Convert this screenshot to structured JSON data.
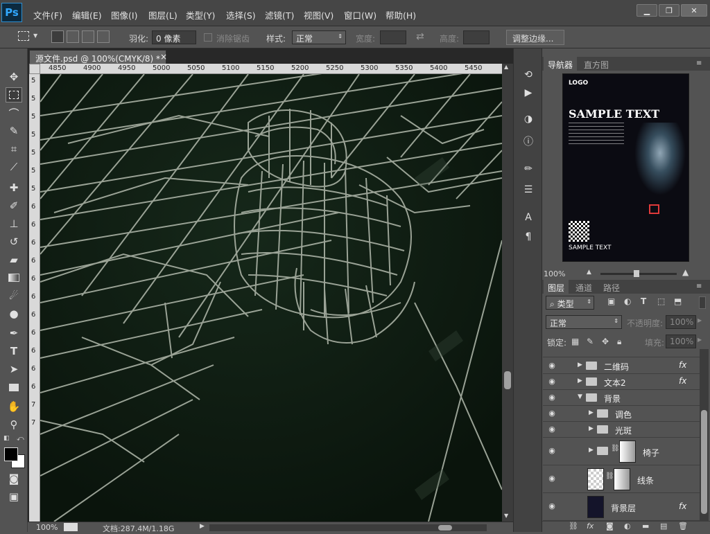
{
  "app": {
    "logo": "Ps"
  },
  "menu": [
    "文件(F)",
    "编辑(E)",
    "图像(I)",
    "图层(L)",
    "类型(Y)",
    "选择(S)",
    "滤镜(T)",
    "视图(V)",
    "窗口(W)",
    "帮助(H)"
  ],
  "window_controls": {
    "minimize": "▁",
    "restore": "❐",
    "close": "✕"
  },
  "options": {
    "feather_label": "羽化:",
    "feather_value": "0 像素",
    "antialias_label": "消除锯齿",
    "style_label": "样式:",
    "style_value": "正常",
    "width_label": "宽度:",
    "height_label": "高度:",
    "refine_button": "调整边缘..."
  },
  "document": {
    "tab_title": "源文件.psd @ 100%(CMYK/8) *",
    "tab_close": "×",
    "ruler_top": [
      "4850",
      "4900",
      "4950",
      "5000",
      "5050",
      "5100",
      "5150",
      "5200",
      "5250",
      "5300",
      "5350",
      "5400",
      "5450"
    ],
    "ruler_left": [
      "5",
      "5",
      "5",
      "5",
      "5",
      "5",
      "5",
      "6",
      "6",
      "6",
      "6",
      "6",
      "6",
      "6",
      "6",
      "6",
      "6",
      "6",
      "7",
      "7"
    ]
  },
  "status": {
    "zoom": "100%",
    "doc_size": "文档:287.4M/1.18G"
  },
  "navigator": {
    "tabs": [
      "导航器",
      "直方图"
    ],
    "zoom": "100%",
    "preview": {
      "logo": "LOGO",
      "headline": "SAMPLE TEXT",
      "footer": "SAMPLE TEXT"
    }
  },
  "layers_panel": {
    "tabs": [
      "图层",
      "通道",
      "路径"
    ],
    "filter_label": "类型",
    "blend_mode": "正常",
    "opacity_label": "不透明度:",
    "opacity_value": "100%",
    "lock_label": "锁定:",
    "fill_label": "填充:",
    "fill_value": "100%",
    "layers": [
      {
        "name": "二维码",
        "type": "group",
        "fx": "fx"
      },
      {
        "name": "文本2",
        "type": "group",
        "fx": "fx"
      },
      {
        "name": "背景",
        "type": "group-open",
        "fx": ""
      },
      {
        "name": "调色",
        "type": "group",
        "fx": ""
      },
      {
        "name": "光斑",
        "type": "group",
        "fx": ""
      },
      {
        "name": "椅子",
        "type": "group-mask",
        "fx": ""
      },
      {
        "name": "线条",
        "type": "layer-mask",
        "fx": ""
      },
      {
        "name": "背景层",
        "type": "layer",
        "fx": "fx"
      }
    ]
  },
  "colors": {
    "canvas_bg": "#0e1a10",
    "wire": "#a9b1a4",
    "selection_accent": "#e03a3a"
  }
}
